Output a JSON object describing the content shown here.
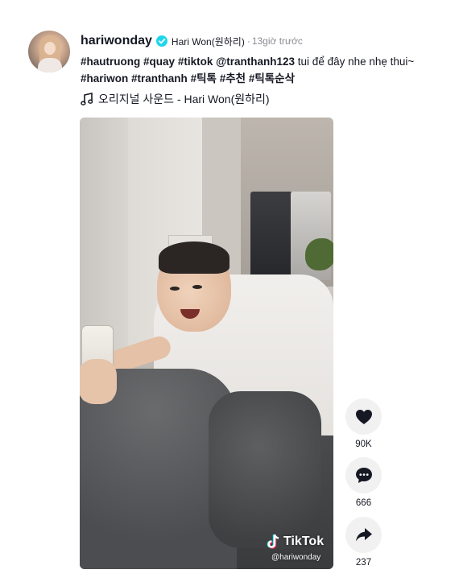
{
  "post": {
    "username": "hariwonday",
    "nickname": "Hari Won(원하리)",
    "time_separator": "·",
    "time_ago": "13giờ trước",
    "caption": {
      "line1_tags": [
        "#hautruong",
        "#quay",
        "#tiktok",
        "@tranthanh123"
      ],
      "line1_text": "tui để đây nhe nhẹ thui~",
      "line2_tags": [
        "#hariwon",
        "#tranthanh",
        "#틱톡",
        "#추천",
        "#틱톡순삭"
      ]
    },
    "sound": {
      "icon": "music-note-icon",
      "title": "오리지널 사운드 - Hari Won(원하리)"
    },
    "video": {
      "watermark_brand": "TikTok",
      "watermark_handle": "@hariwonday"
    },
    "actions": {
      "likes": {
        "icon": "heart-icon",
        "count": "90K"
      },
      "comments": {
        "icon": "comment-icon",
        "count": "666"
      },
      "shares": {
        "icon": "share-icon",
        "count": "237"
      }
    }
  },
  "colors": {
    "text": "#161823",
    "muted": "#8a8b91",
    "verified": "#20d5ec",
    "action_bg": "#f1f1f2"
  }
}
